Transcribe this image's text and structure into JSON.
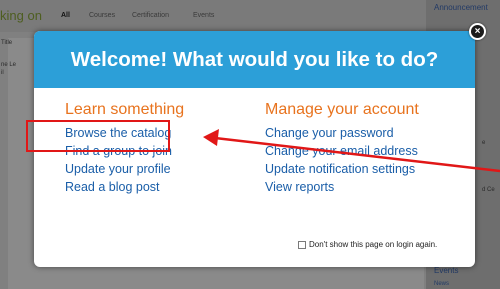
{
  "background": {
    "heading": "king on",
    "tabs": [
      "All",
      "Courses",
      "Certification",
      "Events"
    ],
    "left_snippets": [
      "Title",
      "ne Le",
      "il"
    ],
    "sidebar_titles": [
      "Announcement",
      "Events",
      "News"
    ],
    "sidebar_snippets": [
      "e",
      "d Ce"
    ]
  },
  "modal": {
    "title": "Welcome! What would you like to do?",
    "close_label": "×",
    "learn": {
      "heading": "Learn something",
      "links": [
        "Browse the catalog",
        "Find a group to join",
        "Update your profile",
        "Read a blog post"
      ]
    },
    "manage": {
      "heading": "Manage your account",
      "links": [
        "Change your password",
        "Change your email address",
        "Update notification settings",
        "View reports"
      ]
    },
    "dont_show_label": "Don't show this page on login again."
  },
  "annotation": {
    "box_color": "#e11717",
    "arrow_color": "#e11717"
  },
  "colors": {
    "header_blue": "#2c9fd8",
    "heading_orange": "#e8731e",
    "link_blue": "#1a5ea8"
  }
}
